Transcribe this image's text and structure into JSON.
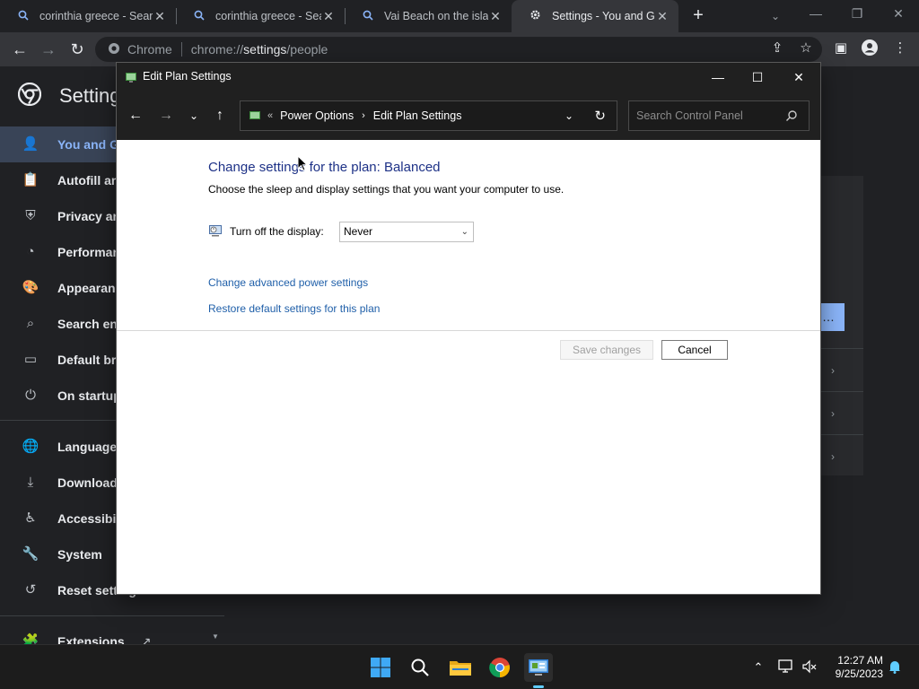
{
  "browser": {
    "tabs": [
      {
        "title": "corinthia greece - Search",
        "icon": "search-icon"
      },
      {
        "title": "corinthia greece - Search",
        "icon": "search-icon"
      },
      {
        "title": "Vai Beach on the island",
        "icon": "search-icon"
      },
      {
        "title": "Settings - You and Google",
        "icon": "gear-icon",
        "active": true
      }
    ],
    "omnibox": {
      "site": "Chrome",
      "url_prefix": "chrome://",
      "url_host": "settings",
      "url_path": "/people"
    }
  },
  "settings_page": {
    "title": "Settings",
    "sidebar": [
      {
        "label": "You and Google",
        "icon": "person-icon",
        "selected": true
      },
      {
        "label": "Autofill and passwords",
        "icon": "clipboard-icon"
      },
      {
        "label": "Privacy and security",
        "icon": "shield-icon"
      },
      {
        "label": "Performance",
        "icon": "speedometer-icon"
      },
      {
        "label": "Appearance",
        "icon": "palette-icon"
      },
      {
        "label": "Search engine",
        "icon": "search-icon"
      },
      {
        "label": "Default browser",
        "icon": "browser-icon"
      },
      {
        "label": "On startup",
        "icon": "power-icon"
      },
      {
        "label": "Languages",
        "icon": "globe-icon"
      },
      {
        "label": "Downloads",
        "icon": "download-icon"
      },
      {
        "label": "Accessibility",
        "icon": "accessibility-icon"
      },
      {
        "label": "System",
        "icon": "wrench-icon"
      },
      {
        "label": "Reset settings",
        "icon": "reset-icon"
      },
      {
        "label": "Extensions",
        "icon": "puzzle-icon"
      }
    ]
  },
  "control_panel": {
    "window_title": "Edit Plan Settings",
    "breadcrumb": [
      "Power Options",
      "Edit Plan Settings"
    ],
    "search_placeholder": "Search Control Panel",
    "heading": "Change settings for the plan: Balanced",
    "subheading": "Choose the sleep and display settings that you want your computer to use.",
    "display_label": "Turn off the display:",
    "display_value": "Never",
    "link_advanced": "Change advanced power settings",
    "link_restore": "Restore default settings for this plan",
    "save_label": "Save changes",
    "cancel_label": "Cancel"
  },
  "taskbar": {
    "apps": [
      "start-icon",
      "search-icon",
      "file-explorer-icon",
      "chrome-icon",
      "control-panel-icon"
    ],
    "time": "12:27 AM",
    "date": "9/25/2023"
  },
  "colors": {
    "link": "#1f5fa9",
    "heading": "#1e3287",
    "accent": "#8ab4f8"
  }
}
